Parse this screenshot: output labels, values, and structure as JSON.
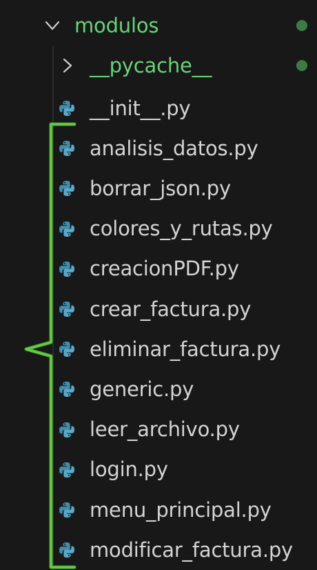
{
  "explorer": {
    "root_folder": {
      "name": "modulos",
      "expanded": true,
      "git_dot": true
    },
    "subfolder": {
      "name": "__pycache__",
      "expanded": false,
      "git_dot": true
    },
    "files": [
      {
        "name": "__init__.py"
      },
      {
        "name": "analisis_datos.py"
      },
      {
        "name": "borrar_json.py"
      },
      {
        "name": "colores_y_rutas.py"
      },
      {
        "name": "creacionPDF.py"
      },
      {
        "name": "crear_factura.py"
      },
      {
        "name": "eliminar_factura.py"
      },
      {
        "name": "generic.py"
      },
      {
        "name": "leer_archivo.py"
      },
      {
        "name": "login.py"
      },
      {
        "name": "menu_principal.py"
      },
      {
        "name": "modificar_factura.py"
      }
    ]
  },
  "colors": {
    "background": "#181818",
    "folder_text": "#6ad27a",
    "file_text": "#d4d4d4",
    "git_dot": "#3e7a46",
    "python_icon": "#3e8fb0",
    "annotation_bracket": "#57c23a"
  },
  "icons": {
    "expanded": "chevron-down-icon",
    "collapsed": "chevron-right-icon",
    "python_file": "python-file-icon"
  }
}
